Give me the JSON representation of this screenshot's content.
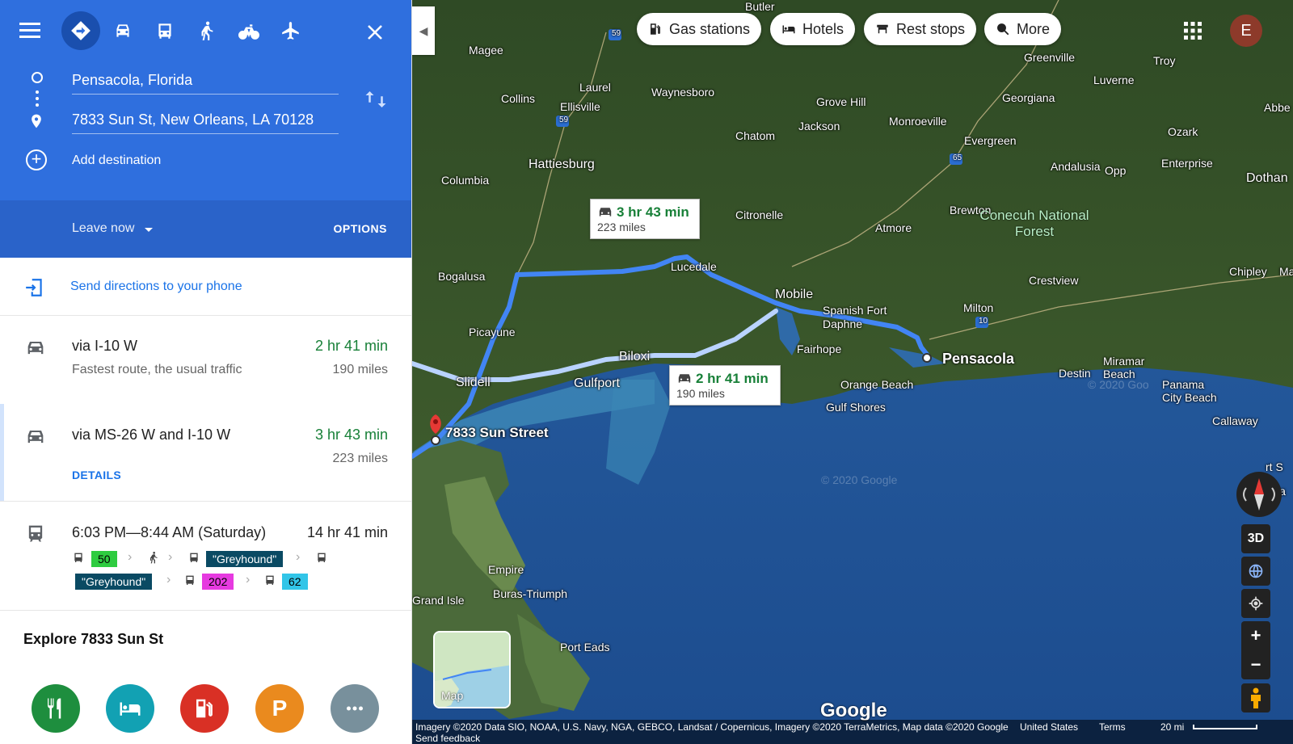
{
  "travel_modes": [
    {
      "name": "best",
      "icon": "directions-icon",
      "active": true
    },
    {
      "name": "driving",
      "icon": "car-icon"
    },
    {
      "name": "transit",
      "icon": "bus-icon"
    },
    {
      "name": "walking",
      "icon": "walk-icon"
    },
    {
      "name": "cycling",
      "icon": "bike-icon"
    },
    {
      "name": "flights",
      "icon": "plane-icon"
    }
  ],
  "origin": {
    "value": "Pensacola, Florida"
  },
  "destination": {
    "value": "7833 Sun St, New Orleans, LA 70128"
  },
  "add_destination_label": "Add destination",
  "leave_now_label": "Leave now",
  "options_label": "OPTIONS",
  "send_directions_label": "Send directions to your phone",
  "routes": [
    {
      "title": "via I-10 W",
      "time": "2 hr 41 min",
      "subtitle": "Fastest route, the usual traffic",
      "distance": "190 miles"
    },
    {
      "title": "via MS-26 W and I-10 W",
      "time": "3 hr 43 min",
      "distance": "223 miles",
      "details_label": "DETAILS"
    }
  ],
  "transit_route": {
    "time_range": "6:03 PM—8:44 AM (Saturday)",
    "duration": "14 hr 41 min",
    "chips": [
      {
        "label": "50",
        "bg": "#2ecc40"
      },
      {
        "label": "\"Greyhound\"",
        "bg": "#0a4a63",
        "fg": "#fff"
      },
      {
        "label": "\"Greyhound\"",
        "bg": "#0a4a63",
        "fg": "#fff"
      },
      {
        "label": "202",
        "bg": "#e63ae0"
      },
      {
        "label": "62",
        "bg": "#32c5e8"
      }
    ]
  },
  "explore": {
    "title": "Explore 7833 Sun St",
    "categories": [
      {
        "name": "restaurants",
        "icon": "fork-knife-icon",
        "color": "#1e8e3e"
      },
      {
        "name": "hotels",
        "icon": "bed-icon",
        "color": "#12a1b3"
      },
      {
        "name": "gas",
        "icon": "gas-pump-icon",
        "color": "#d93025"
      },
      {
        "name": "parking",
        "icon": "parking-icon",
        "color": "#ea8a1e",
        "label": "P"
      },
      {
        "name": "more",
        "icon": "more-icon",
        "color": "#78909c"
      }
    ]
  },
  "map_pills": [
    {
      "label": "Gas stations",
      "icon": "gas-pump-icon"
    },
    {
      "label": "Hotels",
      "icon": "bed-icon"
    },
    {
      "label": "Rest stops",
      "icon": "rest-stop-icon"
    },
    {
      "label": "More",
      "icon": "search-icon"
    }
  ],
  "user_initial": "E",
  "callouts": [
    {
      "time": "3 hr 43 min",
      "distance": "223 miles"
    },
    {
      "time": "2 hr 41 min",
      "distance": "190 miles"
    }
  ],
  "markers": {
    "origin": "Pensacola",
    "destination": "7833 Sun Street"
  },
  "places": [
    "Butler",
    "Magee",
    "Laurel",
    "Waynesboro",
    "Collins",
    "Ellisville",
    "Grove Hill",
    "Greenville",
    "Troy",
    "Luverne",
    "Georgiana",
    "Abbe",
    "Jackson",
    "Chatom",
    "Monroeville",
    "Evergreen",
    "Ozark",
    "Hattiesburg",
    "Columbia",
    "Andalusia",
    "Opp",
    "Enterprise",
    "Dothan",
    "Citronelle",
    "Atmore",
    "Brewton",
    "Lucedale",
    "Bogalusa",
    "Mobile",
    "Chipley",
    "Ma",
    "Crestview",
    "Spanish Fort",
    "Daphne",
    "Milton",
    "Picayune",
    "Biloxi",
    "Fairhope",
    "Slidell",
    "Gulfport",
    "Orange Beach",
    "Destin",
    "Miramar Beach",
    "Panama City Beach",
    "Gulf Shores",
    "Callaway",
    "Empire",
    "Buras-Triumph",
    "Grand Isle",
    "Port Eads",
    "rt S",
    "Apa"
  ],
  "forest_label": "Conecuh National Forest",
  "highway_shields": [
    "59",
    "59",
    "65",
    "10"
  ],
  "controls": {
    "three_d": "3D"
  },
  "mini_map_label": "Map",
  "google_label": "Google",
  "attribution": "Imagery ©2020 Data SIO, NOAA, U.S. Navy, NGA, GEBCO, Landsat / Copernicus, Imagery ©2020 TerraMetrics, Map data ©2020 Google",
  "country_label": "United States",
  "terms_label": "Terms",
  "scale_label": "20 mi",
  "feedback_label": "Send feedback",
  "watermarks": [
    "© 2020 Google",
    "© 2020 Goo"
  ]
}
